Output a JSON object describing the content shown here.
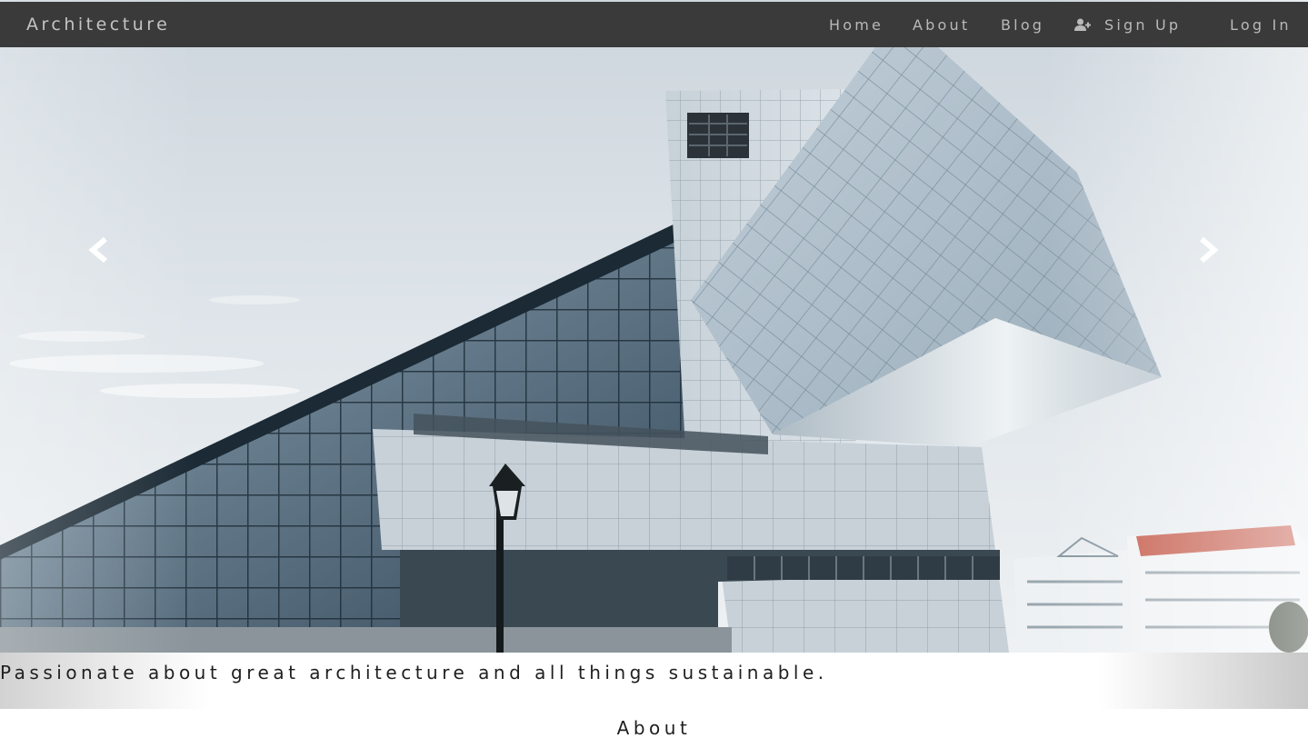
{
  "navbar": {
    "brand": "Architecture",
    "items": [
      {
        "label": "Home"
      },
      {
        "label": "About"
      },
      {
        "label": "Blog"
      },
      {
        "label": "Sign Up",
        "icon": "user-plus-icon"
      },
      {
        "label": "Log In"
      }
    ]
  },
  "carousel": {
    "image": "modern-glass-architecture-building-photo",
    "prev_icon": "chevron-left-icon",
    "next_icon": "chevron-right-icon",
    "caption": "Passionate about great architecture and all things sustainable."
  },
  "about": {
    "title": "About"
  },
  "colors": {
    "navbar_bg": "#3a3a3a",
    "nav_text": "#b9b9b9",
    "body_text": "#1f1f1f"
  }
}
